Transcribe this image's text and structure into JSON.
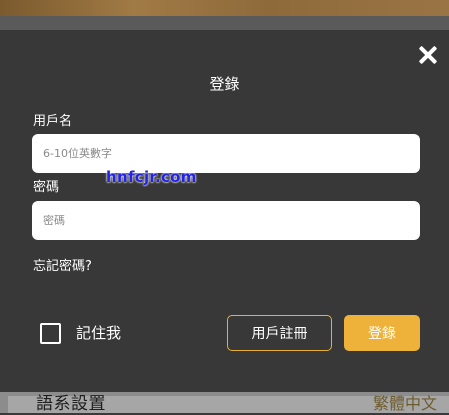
{
  "modal": {
    "title": "登錄",
    "username_label": "用戶名",
    "username_placeholder": "6-10位英數字",
    "password_label": "密碼",
    "password_placeholder": "密碼",
    "forgot_label": "忘記密碼?",
    "remember_label": "記住我",
    "register_label": "用戶註冊",
    "login_label": "登錄"
  },
  "background_page": {
    "language_label": "語系設置",
    "language_value": "繁體中文"
  },
  "watermark": "hnfcjr.com",
  "colors": {
    "modal_bg": "#383838",
    "accent": "#eeb139",
    "text": "#ffffff"
  },
  "icons": {
    "close": "close-icon",
    "checkbox": "checkbox-icon"
  }
}
